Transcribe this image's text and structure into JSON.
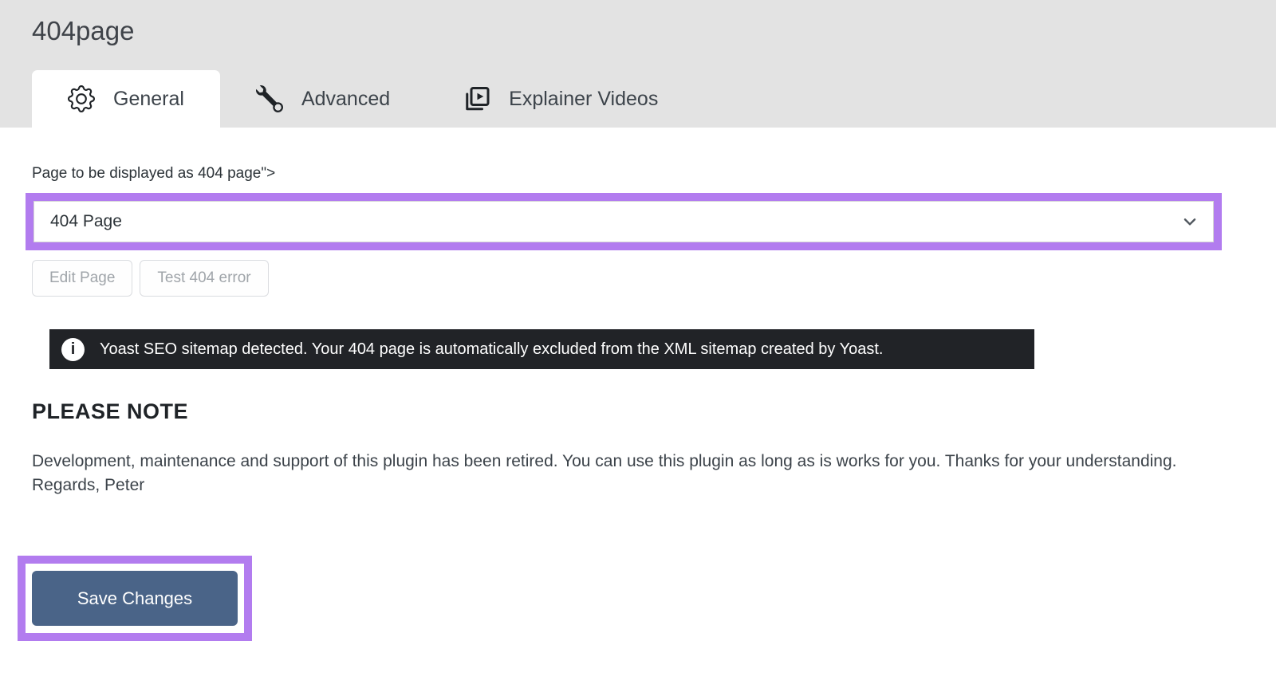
{
  "page": {
    "title": "404page"
  },
  "tabs": [
    {
      "label": "General",
      "icon": "gear-icon",
      "active": true
    },
    {
      "label": "Advanced",
      "icon": "wrench-icon",
      "active": false
    },
    {
      "label": "Explainer Videos",
      "icon": "video-collection-icon",
      "active": false
    }
  ],
  "form": {
    "page_select_label": "Page to be displayed as 404 page\">",
    "page_select_value": "404 Page",
    "edit_page_button": "Edit Page",
    "test_404_button": "Test 404 error"
  },
  "notice": {
    "text": "Yoast SEO sitemap detected. Your 404 page is automatically excluded from the XML sitemap created by Yoast."
  },
  "note": {
    "heading": "PLEASE NOTE",
    "body": "Development, maintenance and support of this plugin has been retired. You can use this plugin as long as is works for you. Thanks for your understanding.",
    "signature": "Regards, Peter"
  },
  "actions": {
    "save_label": "Save Changes"
  },
  "colors": {
    "annotation_highlight": "#b27cef",
    "save_button": "#4a6488",
    "notice_bg": "#212327",
    "header_bg": "#e3e3e3"
  }
}
